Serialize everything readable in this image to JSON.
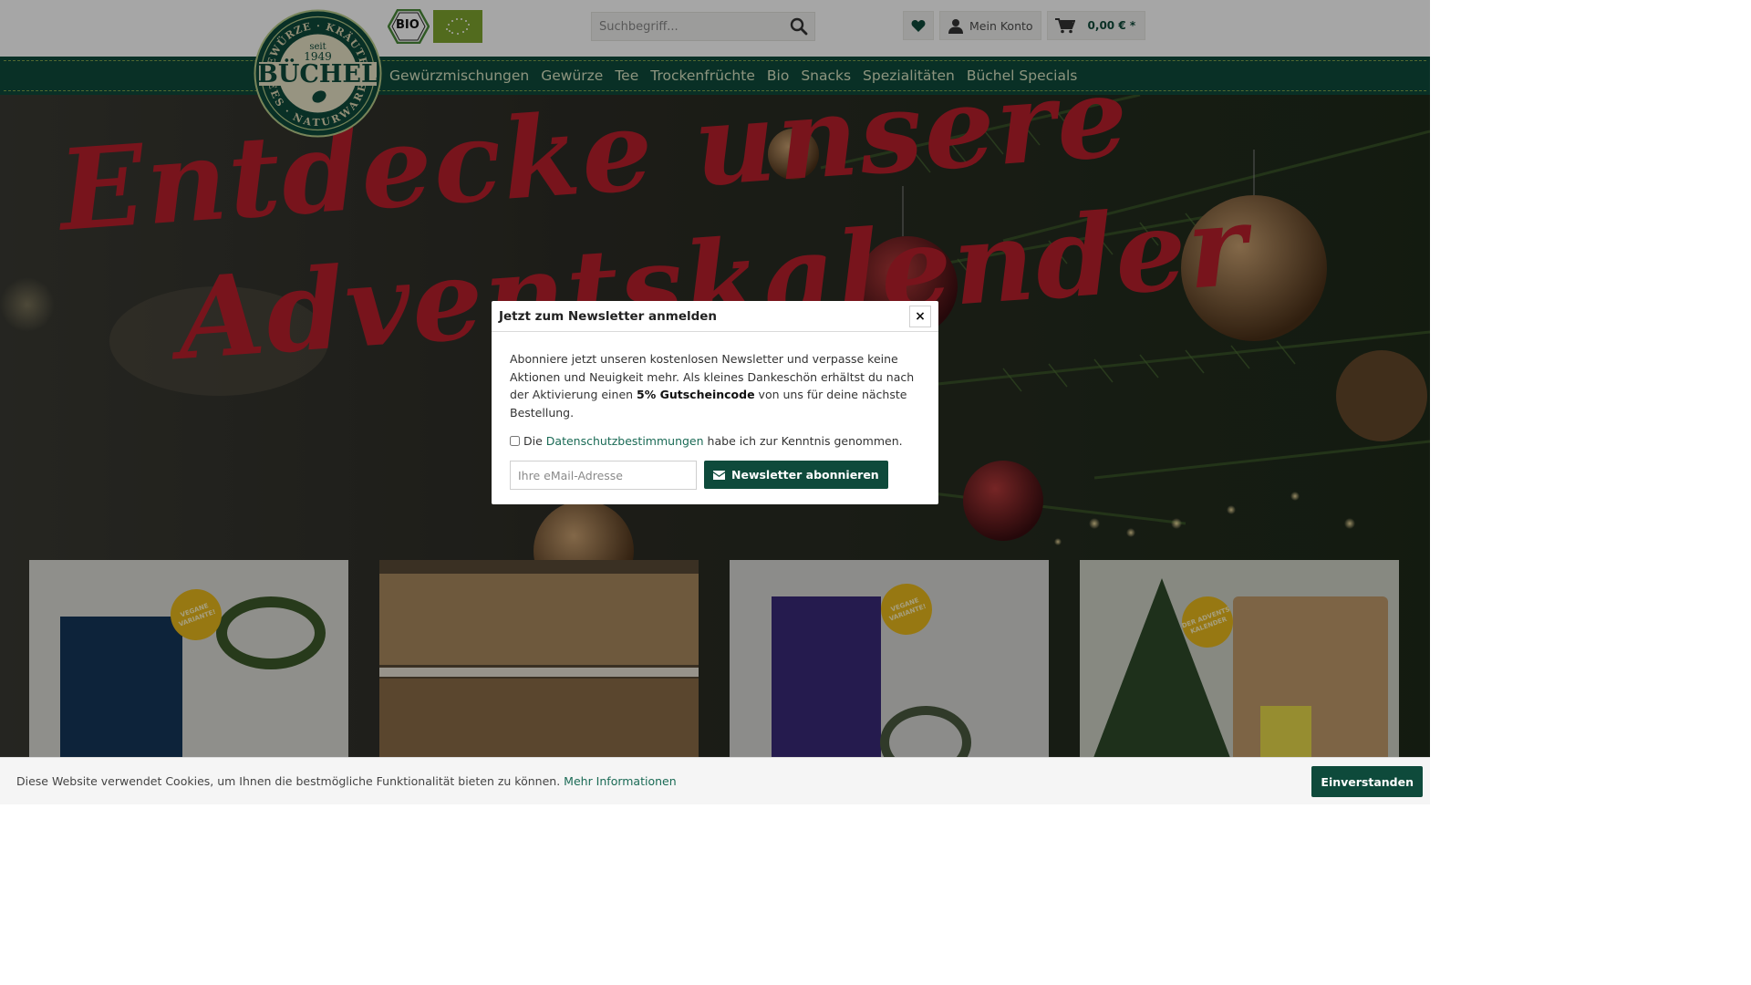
{
  "colors": {
    "brand_green": "#0e4a3b",
    "nav_text": "#d8e3c2",
    "hero_red": "#b8202c",
    "seal_gold": "#e8b81d",
    "bio_green": "#7fa52e"
  },
  "logo": {
    "lettering": "GEWÜRZE · KRÄUTER · TEES · NATURWAREN · seit 1949 · BÜCHEL"
  },
  "badges": {
    "bio_label": "BIO"
  },
  "search": {
    "placeholder": "Suchbegriff..."
  },
  "header_actions": {
    "wishlist_icon": "heart-icon",
    "account_label": "Mein Konto",
    "cart_amount": "0,00 € *"
  },
  "nav": {
    "items": [
      {
        "label": "Gewürzmischungen"
      },
      {
        "label": "Gewürze"
      },
      {
        "label": "Tee"
      },
      {
        "label": "Trockenfrüchte"
      },
      {
        "label": "Bio"
      },
      {
        "label": "Snacks"
      },
      {
        "label": "Spezialitäten"
      },
      {
        "label": "Büchel Specials"
      }
    ]
  },
  "hero": {
    "line1": "Entdecke unsere",
    "line2": "Adventskalender"
  },
  "products": [
    {
      "seal": "VEGANE VARIANTE!"
    },
    {
      "seal": ""
    },
    {
      "seal": "VEGANE VARIANTE!"
    },
    {
      "seal": "DER ADVENTS KALENDER"
    }
  ],
  "newsletter": {
    "title": "Jetzt zum Newsletter anmelden",
    "close_label": "×",
    "text_before": "Abonniere jetzt unseren kostenlosen Newsletter und verpasse keine Aktionen und Neuigkeit mehr. Als kleines Dankeschön erhältst du nach der Aktivierung einen ",
    "text_bold": "5% Gutscheincode",
    "text_after": " von uns für deine nächste Bestellung.",
    "consent_prefix": "Die",
    "consent_link": "Datenschutzbestimmungen",
    "consent_suffix": "habe ich zur Kenntnis genommen.",
    "consent_checked": false,
    "email_placeholder": "Ihre eMail-Adresse",
    "subscribe_label": "Newsletter abonnieren"
  },
  "cookie": {
    "text": "Diese Website verwendet Cookies, um Ihnen die bestmögliche Funktionalität bieten zu können.",
    "link": "Mehr Informationen",
    "accept_label": "Einverstanden"
  }
}
